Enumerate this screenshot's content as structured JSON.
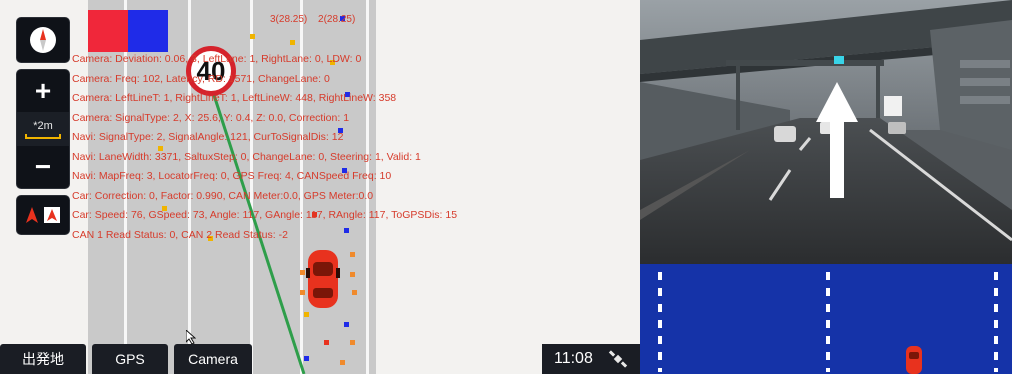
{
  "map": {
    "speed_limit": "40",
    "top_coords": [
      "3(28.25)",
      "2(28.25)"
    ],
    "scale_label": "*2m",
    "overlay_lines": [
      "Camera: Deviation: 0.06, 3, LeftLane: 1, RightLane: 0, LDW: 0",
      "Camera: Freq: 102, Latency, RD: 1571, ChangeLane: 0",
      "Camera: LeftLineT: 1, RightLineT: 1, LeftLineW: 448, RightLineW: 358",
      "Camera: SignalType: 2, X: 25.6, Y: 0.4, Z: 0.0, Correction: 1",
      "Navi: SignalType: 2, SignalAngle: 121, CurToSignalDis: 12",
      "Navi: LaneWidth: 3371, SaltuxStep: 0, ChangeLane: 0, Steering: 1, Valid: 1",
      "Navi: MapFreq: 3, LocatorFreq: 0, GPS Freq: 4, CANSpeed Freq: 10",
      "Car: Correction: 0, Factor: 0.990, CAN Meter:0.0, GPS Meter:0.0",
      "Car: Speed: 76, GSpeed: 73, Angle: 117, GAngle: 117, RAngle: 117, ToGPSDis: 15",
      "CAN 1 Read Status: 0, CAN 2 Read Status: -2"
    ],
    "icons": {
      "compass": "compass-icon",
      "zoom_in": "plus-icon",
      "zoom_out": "minus-icon",
      "nav_mode": "navigation-arrow-icon",
      "gps_status": "satellite-icon"
    }
  },
  "bottom_bar": {
    "origin_label": "出発地",
    "gps_label": "GPS",
    "camera_label": "Camera",
    "clock": "11:08"
  },
  "colors": {
    "overlay_text": "#d63b2b",
    "route_line": "#2e9e4a",
    "radar_bg": "#1533a8",
    "car": "#e8321e"
  }
}
